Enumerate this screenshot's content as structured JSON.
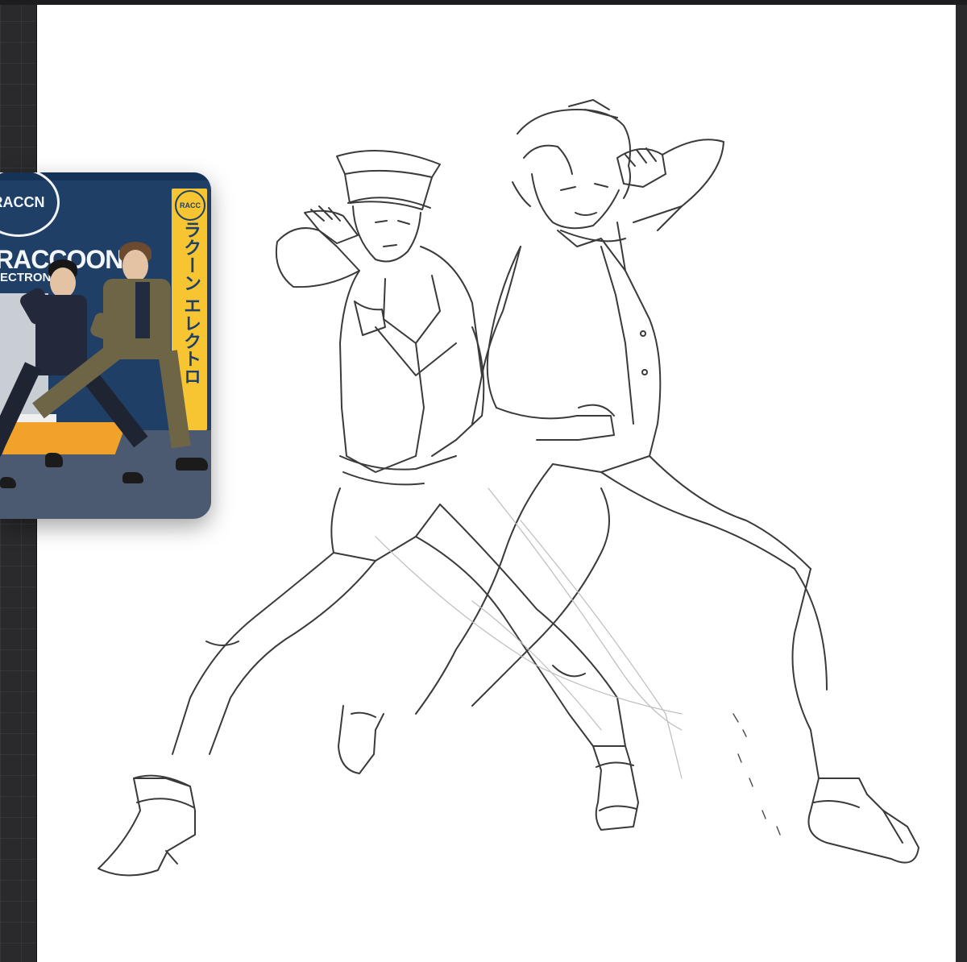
{
  "reference_photo": {
    "logo_text": "RACCN",
    "brand_text": "RACCOON",
    "brand_sub_text": "ECTRONI",
    "banner_logo_text": "RACC",
    "banner_text": "ラクーン エレクトロ"
  }
}
